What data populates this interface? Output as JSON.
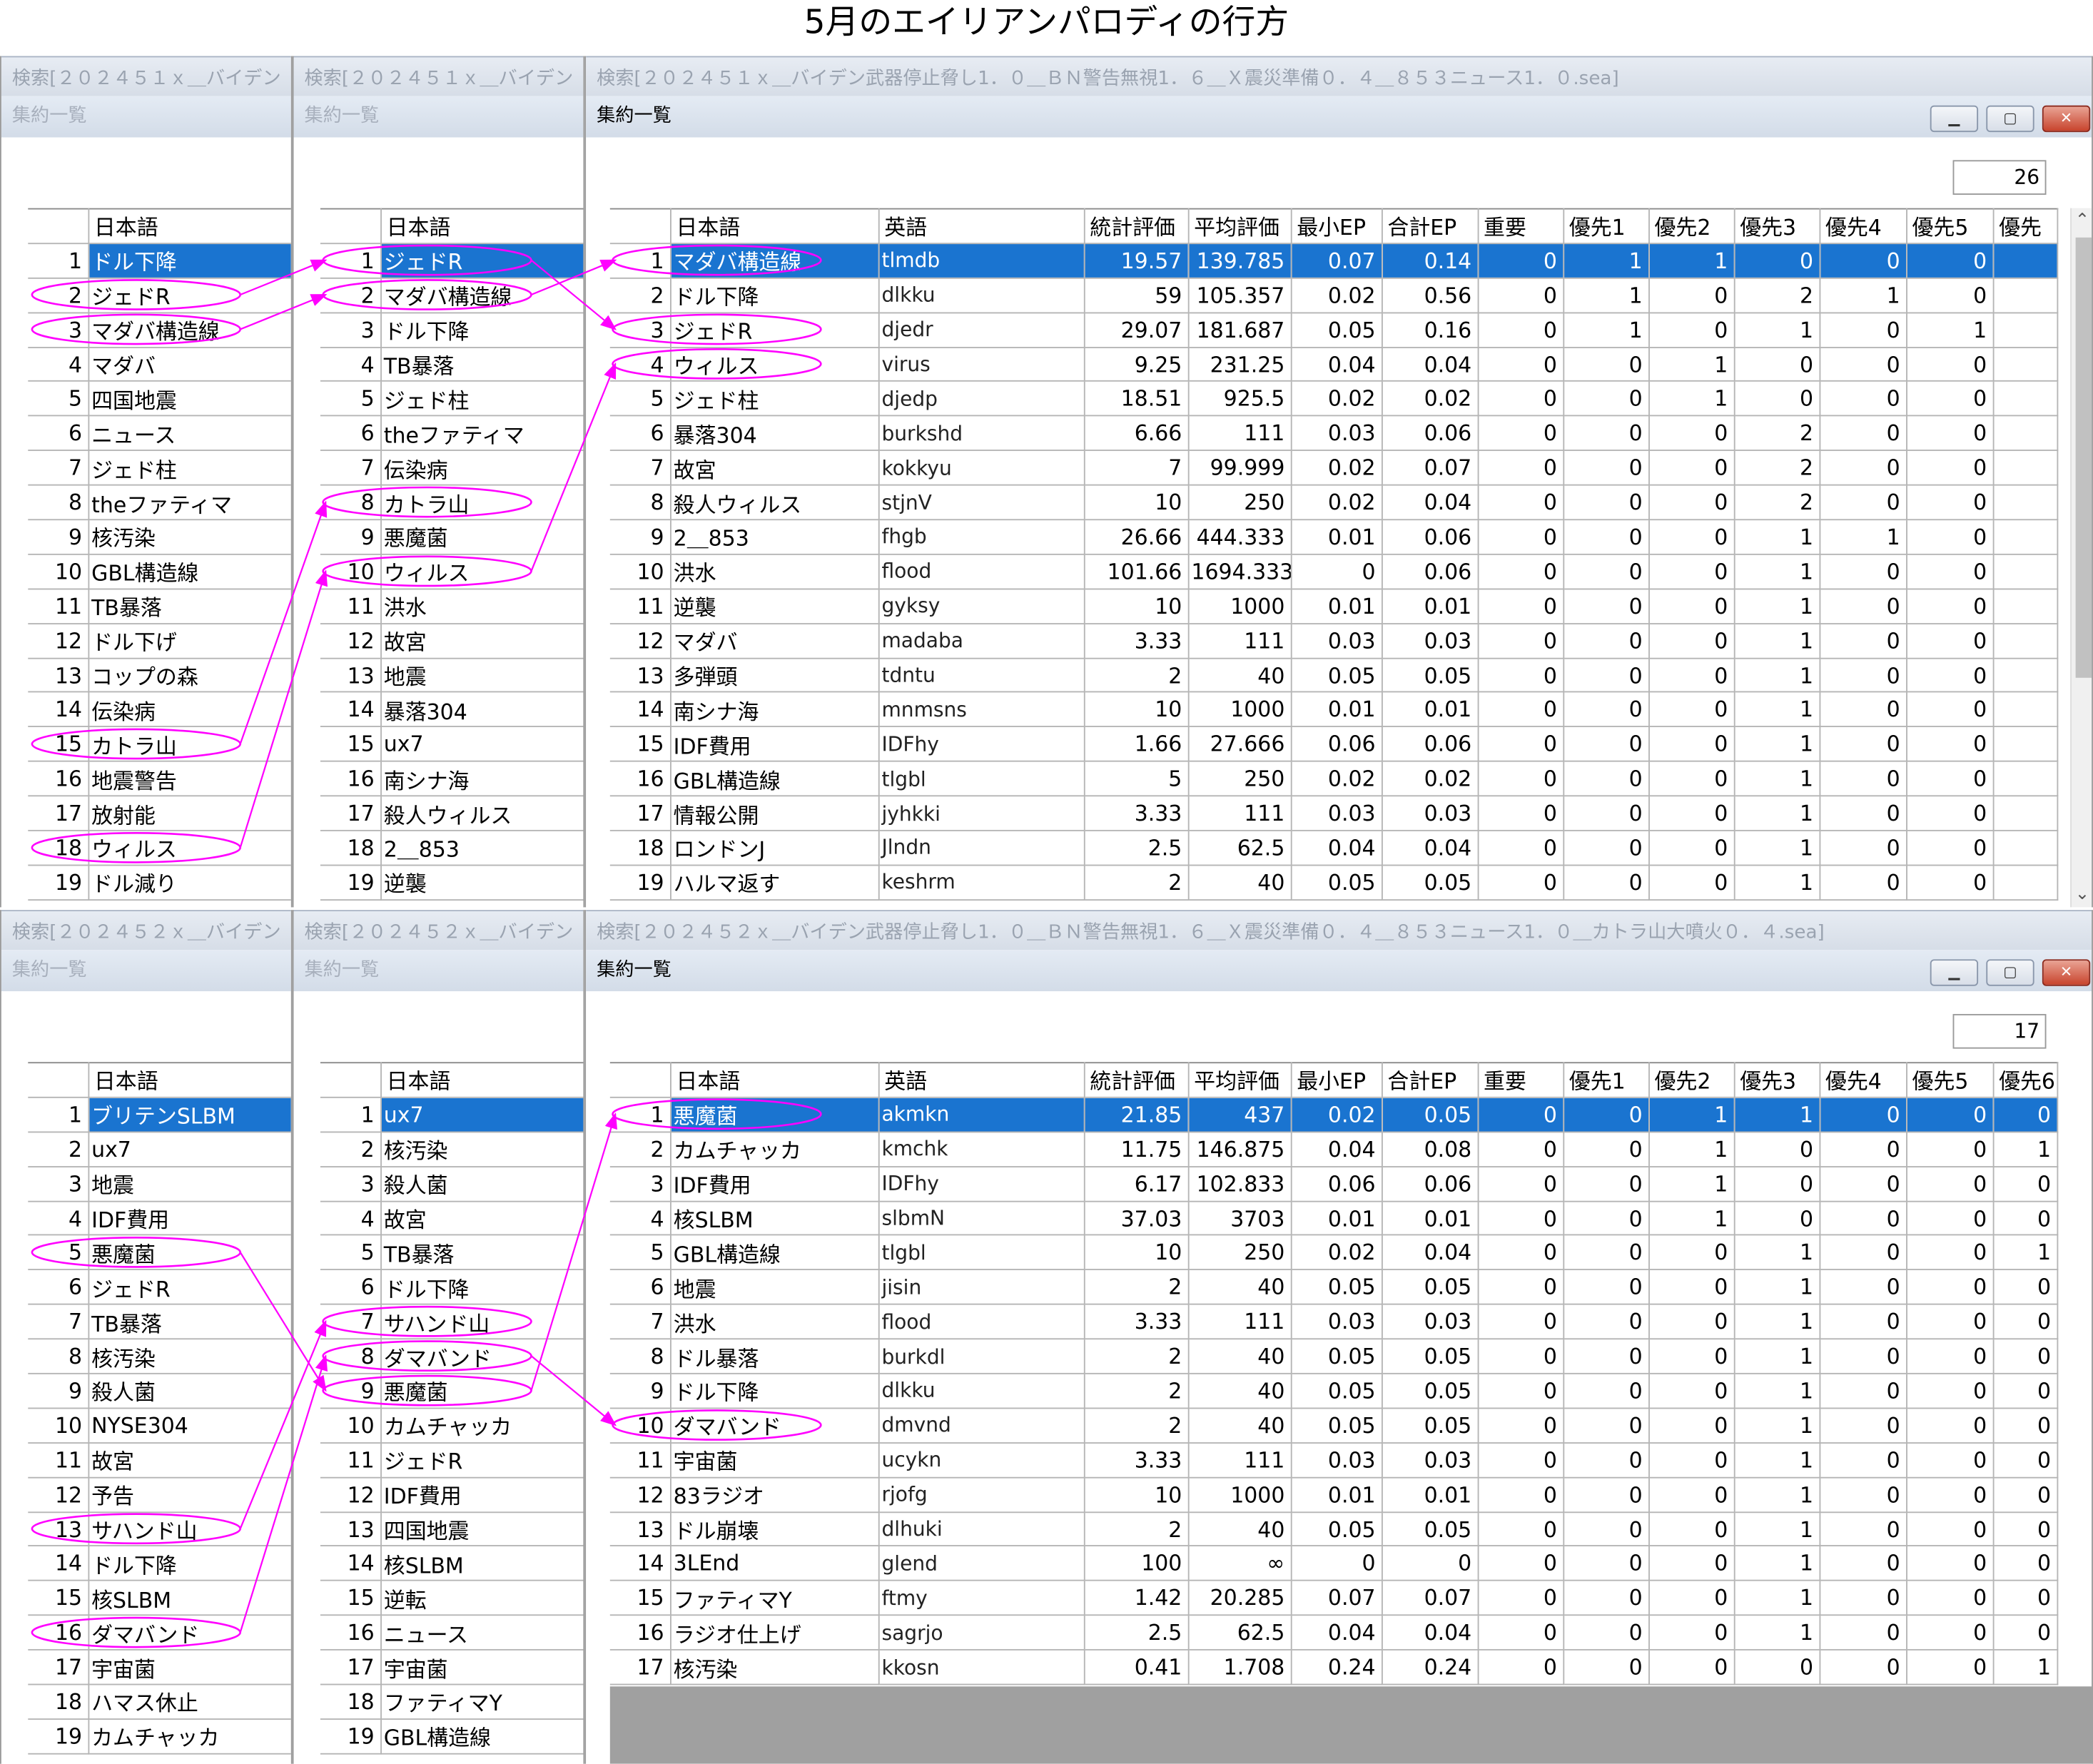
{
  "page_title": "5月のエイリアンパロディの行方",
  "annotation_color": "#ff00ff",
  "selection_color": "#1a74d0",
  "panels": {
    "top": {
      "outer_titles": [
        "検索[２０２４５１ｘ＿バイデン",
        "検索[２０２４５１ｘ＿バイデン",
        "検索[２０２４５１ｘ＿バイデン武器停止脅し1．０＿ＢＮ警告無視1．６＿Ｘ震災準備０．４＿８５３ニュース1．０.sea]"
      ],
      "inner_title": "集約一覧",
      "count": "26",
      "left_header": "日本語",
      "left_rows": [
        [
          "1",
          "ドル下降"
        ],
        [
          "2",
          "ジェドR"
        ],
        [
          "3",
          "マダバ構造線"
        ],
        [
          "4",
          "マダバ"
        ],
        [
          "5",
          "四国地震"
        ],
        [
          "6",
          "ニュース"
        ],
        [
          "7",
          "ジェド柱"
        ],
        [
          "8",
          "theファティマ"
        ],
        [
          "9",
          "核汚染"
        ],
        [
          "10",
          "GBL構造線"
        ],
        [
          "11",
          "TB暴落"
        ],
        [
          "12",
          "ドル下げ"
        ],
        [
          "13",
          "コップの森"
        ],
        [
          "14",
          "伝染病"
        ],
        [
          "15",
          "カトラ山"
        ],
        [
          "16",
          "地震警告"
        ],
        [
          "17",
          "放射能"
        ],
        [
          "18",
          "ウィルス"
        ],
        [
          "19",
          "ドル減り"
        ]
      ],
      "mid_header": "日本語",
      "mid_rows": [
        [
          "1",
          "ジェドR"
        ],
        [
          "2",
          "マダバ構造線"
        ],
        [
          "3",
          "ドル下降"
        ],
        [
          "4",
          "TB暴落"
        ],
        [
          "5",
          "ジェド柱"
        ],
        [
          "6",
          "theファティマ"
        ],
        [
          "7",
          "伝染病"
        ],
        [
          "8",
          "カトラ山"
        ],
        [
          "9",
          "悪魔菌"
        ],
        [
          "10",
          "ウィルス"
        ],
        [
          "11",
          "洪水"
        ],
        [
          "12",
          "故宮"
        ],
        [
          "13",
          "地震"
        ],
        [
          "14",
          "暴落304"
        ],
        [
          "15",
          "ux7"
        ],
        [
          "16",
          "南シナ海"
        ],
        [
          "17",
          "殺人ウィルス"
        ],
        [
          "18",
          "2＿853"
        ],
        [
          "19",
          "逆襲"
        ]
      ],
      "main_headers": [
        "日本語",
        "英語",
        "統計評価",
        "平均評価",
        "最小EP",
        "合計EP",
        "重要",
        "優先1",
        "優先2",
        "優先3",
        "優先4",
        "優先5",
        "優先"
      ],
      "main_rows": [
        [
          "1",
          "マダバ構造線",
          "tlmdb",
          "19.57",
          "139.785",
          "0.07",
          "0.14",
          "0",
          "1",
          "1",
          "0",
          "0",
          "0"
        ],
        [
          "2",
          "ドル下降",
          "dlkku",
          "59",
          "105.357",
          "0.02",
          "0.56",
          "0",
          "1",
          "0",
          "2",
          "1",
          "0"
        ],
        [
          "3",
          "ジェドR",
          "djedr",
          "29.07",
          "181.687",
          "0.05",
          "0.16",
          "0",
          "1",
          "0",
          "1",
          "0",
          "1"
        ],
        [
          "4",
          "ウィルス",
          "virus",
          "9.25",
          "231.25",
          "0.04",
          "0.04",
          "0",
          "0",
          "1",
          "0",
          "0",
          "0"
        ],
        [
          "5",
          "ジェド柱",
          "djedp",
          "18.51",
          "925.5",
          "0.02",
          "0.02",
          "0",
          "0",
          "1",
          "0",
          "0",
          "0"
        ],
        [
          "6",
          "暴落304",
          "burkshd",
          "6.66",
          "111",
          "0.03",
          "0.06",
          "0",
          "0",
          "0",
          "2",
          "0",
          "0"
        ],
        [
          "7",
          "故宮",
          "kokkyu",
          "7",
          "99.999",
          "0.02",
          "0.07",
          "0",
          "0",
          "0",
          "2",
          "0",
          "0"
        ],
        [
          "8",
          "殺人ウィルス",
          "stjnV",
          "10",
          "250",
          "0.02",
          "0.04",
          "0",
          "0",
          "0",
          "2",
          "0",
          "0"
        ],
        [
          "9",
          "2＿853",
          "fhgb",
          "26.66",
          "444.333",
          "0.01",
          "0.06",
          "0",
          "0",
          "0",
          "1",
          "1",
          "0"
        ],
        [
          "10",
          "洪水",
          "flood",
          "101.66",
          "1694.333",
          "0",
          "0.06",
          "0",
          "0",
          "0",
          "1",
          "0",
          "0"
        ],
        [
          "11",
          "逆襲",
          "gyksy",
          "10",
          "1000",
          "0.01",
          "0.01",
          "0",
          "0",
          "0",
          "1",
          "0",
          "0"
        ],
        [
          "12",
          "マダバ",
          "madaba",
          "3.33",
          "111",
          "0.03",
          "0.03",
          "0",
          "0",
          "0",
          "1",
          "0",
          "0"
        ],
        [
          "13",
          "多弾頭",
          "tdntu",
          "2",
          "40",
          "0.05",
          "0.05",
          "0",
          "0",
          "0",
          "1",
          "0",
          "0"
        ],
        [
          "14",
          "南シナ海",
          "mnmsns",
          "10",
          "1000",
          "0.01",
          "0.01",
          "0",
          "0",
          "0",
          "1",
          "0",
          "0"
        ],
        [
          "15",
          "IDF費用",
          "IDFhy",
          "1.66",
          "27.666",
          "0.06",
          "0.06",
          "0",
          "0",
          "0",
          "1",
          "0",
          "0"
        ],
        [
          "16",
          "GBL構造線",
          "tlgbl",
          "5",
          "250",
          "0.02",
          "0.02",
          "0",
          "0",
          "0",
          "1",
          "0",
          "0"
        ],
        [
          "17",
          "情報公開",
          "jyhkki",
          "3.33",
          "111",
          "0.03",
          "0.03",
          "0",
          "0",
          "0",
          "1",
          "0",
          "0"
        ],
        [
          "18",
          "ロンドンJ",
          "Jlndn",
          "2.5",
          "62.5",
          "0.04",
          "0.04",
          "0",
          "0",
          "0",
          "1",
          "0",
          "0"
        ],
        [
          "19",
          "ハルマ返す",
          "keshrm",
          "2",
          "40",
          "0.05",
          "0.05",
          "0",
          "0",
          "0",
          "1",
          "0",
          "0"
        ]
      ]
    },
    "bottom": {
      "outer_titles": [
        "検索[２０２４５２ｘ＿バイデン",
        "検索[２０２４５２ｘ＿バイデン",
        "検索[２０２４５２ｘ＿バイデン武器停止脅し1．０＿ＢＮ警告無視1．６＿Ｘ震災準備０．４＿８５３ニュース1．０＿カトラ山大噴火０．４.sea]"
      ],
      "inner_title": "集約一覧",
      "count": "17",
      "left_header": "日本語",
      "left_rows": [
        [
          "1",
          "ブリテンSLBM"
        ],
        [
          "2",
          "ux7"
        ],
        [
          "3",
          "地震"
        ],
        [
          "4",
          "IDF費用"
        ],
        [
          "5",
          "悪魔菌"
        ],
        [
          "6",
          "ジェドR"
        ],
        [
          "7",
          "TB暴落"
        ],
        [
          "8",
          "核汚染"
        ],
        [
          "9",
          "殺人菌"
        ],
        [
          "10",
          "NYSE304"
        ],
        [
          "11",
          "故宮"
        ],
        [
          "12",
          "予告"
        ],
        [
          "13",
          "サハンド山"
        ],
        [
          "14",
          "ドル下降"
        ],
        [
          "15",
          "核SLBM"
        ],
        [
          "16",
          "ダマバンド"
        ],
        [
          "17",
          "宇宙菌"
        ],
        [
          "18",
          "ハマス休止"
        ],
        [
          "19",
          "カムチャッカ"
        ]
      ],
      "mid_header": "日本語",
      "mid_rows": [
        [
          "1",
          "ux7"
        ],
        [
          "2",
          "核汚染"
        ],
        [
          "3",
          "殺人菌"
        ],
        [
          "4",
          "故宮"
        ],
        [
          "5",
          "TB暴落"
        ],
        [
          "6",
          "ドル下降"
        ],
        [
          "7",
          "サハンド山"
        ],
        [
          "8",
          "ダマバンド"
        ],
        [
          "9",
          "悪魔菌"
        ],
        [
          "10",
          "カムチャッカ"
        ],
        [
          "11",
          "ジェドR"
        ],
        [
          "12",
          "IDF費用"
        ],
        [
          "13",
          "四国地震"
        ],
        [
          "14",
          "核SLBM"
        ],
        [
          "15",
          "逆転"
        ],
        [
          "16",
          "ニュース"
        ],
        [
          "17",
          "宇宙菌"
        ],
        [
          "18",
          "ファティマY"
        ],
        [
          "19",
          "GBL構造線"
        ]
      ],
      "main_headers": [
        "日本語",
        "英語",
        "統計評価",
        "平均評価",
        "最小EP",
        "合計EP",
        "重要",
        "優先1",
        "優先2",
        "優先3",
        "優先4",
        "優先5",
        "優先6"
      ],
      "main_rows": [
        [
          "1",
          "悪魔菌",
          "akmkn",
          "21.85",
          "437",
          "0.02",
          "0.05",
          "0",
          "0",
          "1",
          "1",
          "0",
          "0",
          "0"
        ],
        [
          "2",
          "カムチャッカ",
          "kmchk",
          "11.75",
          "146.875",
          "0.04",
          "0.08",
          "0",
          "0",
          "1",
          "0",
          "0",
          "0",
          "1"
        ],
        [
          "3",
          "IDF費用",
          "IDFhy",
          "6.17",
          "102.833",
          "0.06",
          "0.06",
          "0",
          "0",
          "1",
          "0",
          "0",
          "0",
          "0"
        ],
        [
          "4",
          "核SLBM",
          "slbmN",
          "37.03",
          "3703",
          "0.01",
          "0.01",
          "0",
          "0",
          "1",
          "0",
          "0",
          "0",
          "0"
        ],
        [
          "5",
          "GBL構造線",
          "tlgbl",
          "10",
          "250",
          "0.02",
          "0.04",
          "0",
          "0",
          "0",
          "1",
          "0",
          "0",
          "1"
        ],
        [
          "6",
          "地震",
          "jisin",
          "2",
          "40",
          "0.05",
          "0.05",
          "0",
          "0",
          "0",
          "1",
          "0",
          "0",
          "0"
        ],
        [
          "7",
          "洪水",
          "flood",
          "3.33",
          "111",
          "0.03",
          "0.03",
          "0",
          "0",
          "0",
          "1",
          "0",
          "0",
          "0"
        ],
        [
          "8",
          "ドル暴落",
          "burkdl",
          "2",
          "40",
          "0.05",
          "0.05",
          "0",
          "0",
          "0",
          "1",
          "0",
          "0",
          "0"
        ],
        [
          "9",
          "ドル下降",
          "dlkku",
          "2",
          "40",
          "0.05",
          "0.05",
          "0",
          "0",
          "0",
          "1",
          "0",
          "0",
          "0"
        ],
        [
          "10",
          "ダマバンド",
          "dmvnd",
          "2",
          "40",
          "0.05",
          "0.05",
          "0",
          "0",
          "0",
          "1",
          "0",
          "0",
          "0"
        ],
        [
          "11",
          "宇宙菌",
          "ucykn",
          "3.33",
          "111",
          "0.03",
          "0.03",
          "0",
          "0",
          "0",
          "1",
          "0",
          "0",
          "0"
        ],
        [
          "12",
          "83ラジオ",
          "rjofg",
          "10",
          "1000",
          "0.01",
          "0.01",
          "0",
          "0",
          "0",
          "1",
          "0",
          "0",
          "0"
        ],
        [
          "13",
          "ドル崩壊",
          "dlhuki",
          "2",
          "40",
          "0.05",
          "0.05",
          "0",
          "0",
          "0",
          "1",
          "0",
          "0",
          "0"
        ],
        [
          "14",
          "3LEnd",
          "glend",
          "100",
          "∞",
          "0",
          "0",
          "0",
          "0",
          "0",
          "1",
          "0",
          "0",
          "0"
        ],
        [
          "15",
          "ファティマY",
          "ftmy",
          "1.42",
          "20.285",
          "0.07",
          "0.07",
          "0",
          "0",
          "0",
          "1",
          "0",
          "0",
          "0"
        ],
        [
          "16",
          "ラジオ仕上げ",
          "sagrjo",
          "2.5",
          "62.5",
          "0.04",
          "0.04",
          "0",
          "0",
          "0",
          "1",
          "0",
          "0",
          "0"
        ],
        [
          "17",
          "核汚染",
          "kkosn",
          "0.41",
          "1.708",
          "0.24",
          "0.24",
          "0",
          "0",
          "0",
          "0",
          "0",
          "0",
          "1"
        ]
      ]
    }
  }
}
